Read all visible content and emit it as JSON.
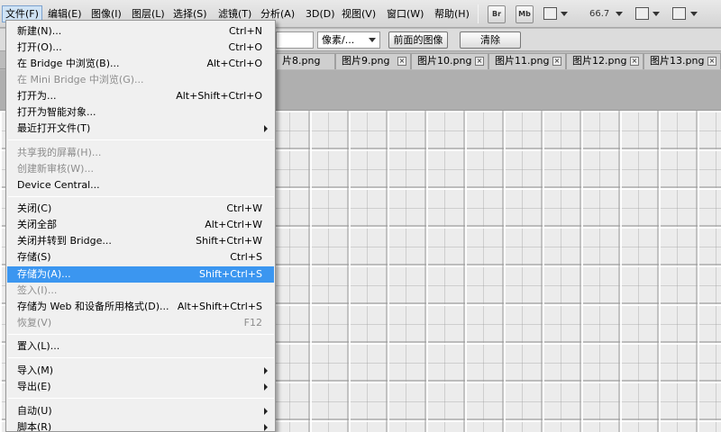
{
  "menubar": {
    "items": [
      "文件(F)",
      "编辑(E)",
      "图像(I)",
      "图层(L)",
      "选择(S)",
      "滤镜(T)",
      "分析(A)",
      "3D(D)",
      "视图(V)",
      "窗口(W)",
      "帮助(H)"
    ],
    "bridge_btn": "Br",
    "minibridge_btn": "Mb",
    "zoom": "66.7"
  },
  "options": {
    "unit_select": "像素/...",
    "front_image_button": "前面的图像",
    "clear_button": "清除"
  },
  "tabs": [
    "片8.png",
    "图片9.png",
    "图片10.png",
    "图片11.png",
    "图片12.png",
    "图片13.png"
  ],
  "file_menu": {
    "items": [
      {
        "label": "新建(N)...",
        "shortcut": "Ctrl+N"
      },
      {
        "label": "打开(O)...",
        "shortcut": "Ctrl+O"
      },
      {
        "label": "在 Bridge 中浏览(B)...",
        "shortcut": "Alt+Ctrl+O"
      },
      {
        "label": "在 Mini Bridge 中浏览(G)...",
        "shortcut": ""
      },
      {
        "label": "打开为...",
        "shortcut": "Alt+Shift+Ctrl+O"
      },
      {
        "label": "打开为智能对象...",
        "shortcut": ""
      },
      {
        "label": "最近打开文件(T)",
        "shortcut": ""
      },
      {
        "label": "共享我的屏幕(H)...",
        "shortcut": ""
      },
      {
        "label": "创建新审核(W)...",
        "shortcut": ""
      },
      {
        "label": "Device Central...",
        "shortcut": ""
      },
      {
        "label": "关闭(C)",
        "shortcut": "Ctrl+W"
      },
      {
        "label": "关闭全部",
        "shortcut": "Alt+Ctrl+W"
      },
      {
        "label": "关闭并转到 Bridge...",
        "shortcut": "Shift+Ctrl+W"
      },
      {
        "label": "存储(S)",
        "shortcut": "Ctrl+S"
      },
      {
        "label": "存储为(A)...",
        "shortcut": "Shift+Ctrl+S"
      },
      {
        "label": "签入(I)...",
        "shortcut": ""
      },
      {
        "label": "存储为 Web 和设备所用格式(D)...",
        "shortcut": "Alt+Shift+Ctrl+S"
      },
      {
        "label": "恢复(V)",
        "shortcut": "F12"
      },
      {
        "label": "置入(L)...",
        "shortcut": ""
      },
      {
        "label": "导入(M)",
        "shortcut": ""
      },
      {
        "label": "导出(E)",
        "shortcut": ""
      },
      {
        "label": "自动(U)",
        "shortcut": ""
      },
      {
        "label": "脚本(R)",
        "shortcut": ""
      }
    ]
  }
}
